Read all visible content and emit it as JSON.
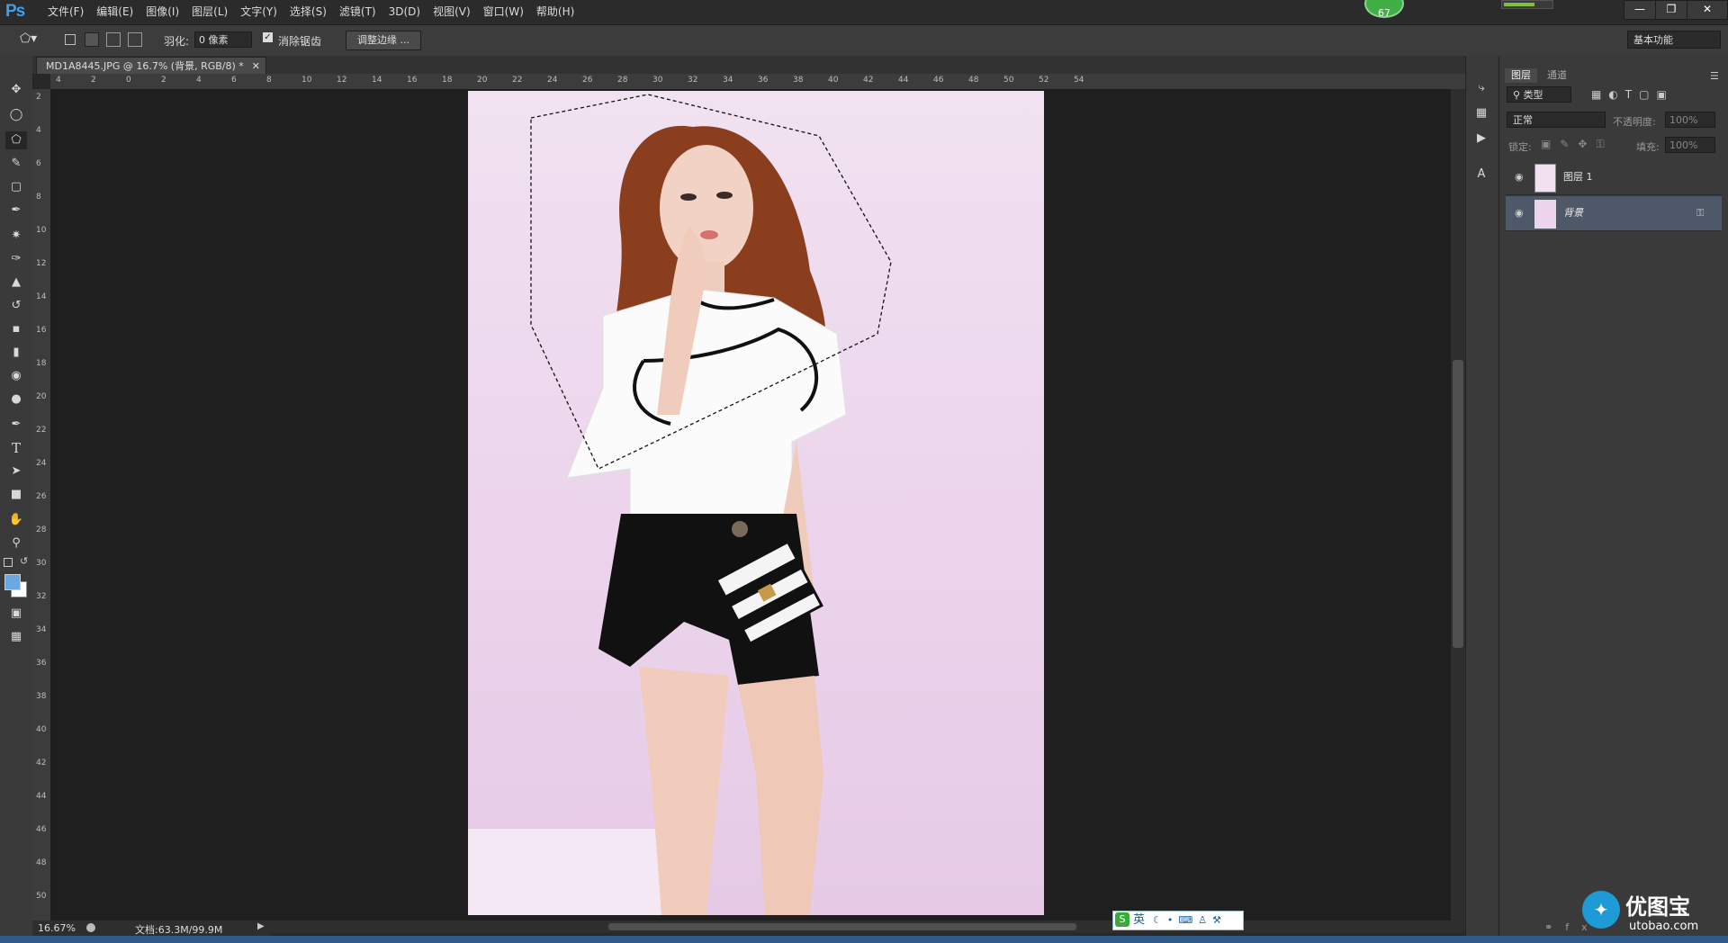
{
  "app": {
    "logo": "Ps"
  },
  "menu": [
    "文件(F)",
    "编辑(E)",
    "图像(I)",
    "图层(L)",
    "文字(Y)",
    "选择(S)",
    "滤镜(T)",
    "3D(D)",
    "视图(V)",
    "窗口(W)",
    "帮助(H)"
  ],
  "badge": "67",
  "options": {
    "feather_label": "羽化:",
    "feather_value": "0 像素",
    "antialias_label": "消除锯齿",
    "refine_edge": "调整边缘 ...",
    "workspace": "基本功能"
  },
  "document": {
    "tab_title": "MD1A8445.JPG @ 16.7% (背景, RGB/8) *",
    "zoom": "16.67%",
    "doc_size": "文档:63.3M/99.9M"
  },
  "rulers": {
    "h": [
      "4",
      "2",
      "0",
      "2",
      "4",
      "6",
      "8",
      "10",
      "12",
      "14",
      "16",
      "18",
      "20",
      "22",
      "24",
      "26",
      "28",
      "30",
      "32",
      "34",
      "36",
      "38",
      "40",
      "42",
      "44",
      "46",
      "48",
      "50",
      "52",
      "54"
    ],
    "v": [
      "2",
      "4",
      "6",
      "8",
      "10",
      "12",
      "14",
      "16",
      "18",
      "20",
      "22",
      "24",
      "26",
      "28",
      "30",
      "32",
      "34",
      "36",
      "38",
      "40",
      "42",
      "44",
      "46",
      "48",
      "50"
    ]
  },
  "panel": {
    "tabs": [
      "图层",
      "通道"
    ],
    "filter": "类型",
    "blend_mode": "正常",
    "opacity_label": "不透明度:",
    "opacity_value": "100%",
    "lock_label": "锁定:",
    "fill_label": "填充:",
    "fill_value": "100%",
    "layers": [
      {
        "name": "图层 1",
        "selected": false
      },
      {
        "name": "背景",
        "selected": true
      }
    ]
  },
  "ime": {
    "label": "英"
  },
  "watermark": {
    "brand": "优图宝",
    "url": "utobao.com"
  },
  "colors": {
    "accent": "#3fa0e8",
    "selection": "#4f5868",
    "foreground": "#6aa8e0",
    "background": "#ffffff"
  }
}
